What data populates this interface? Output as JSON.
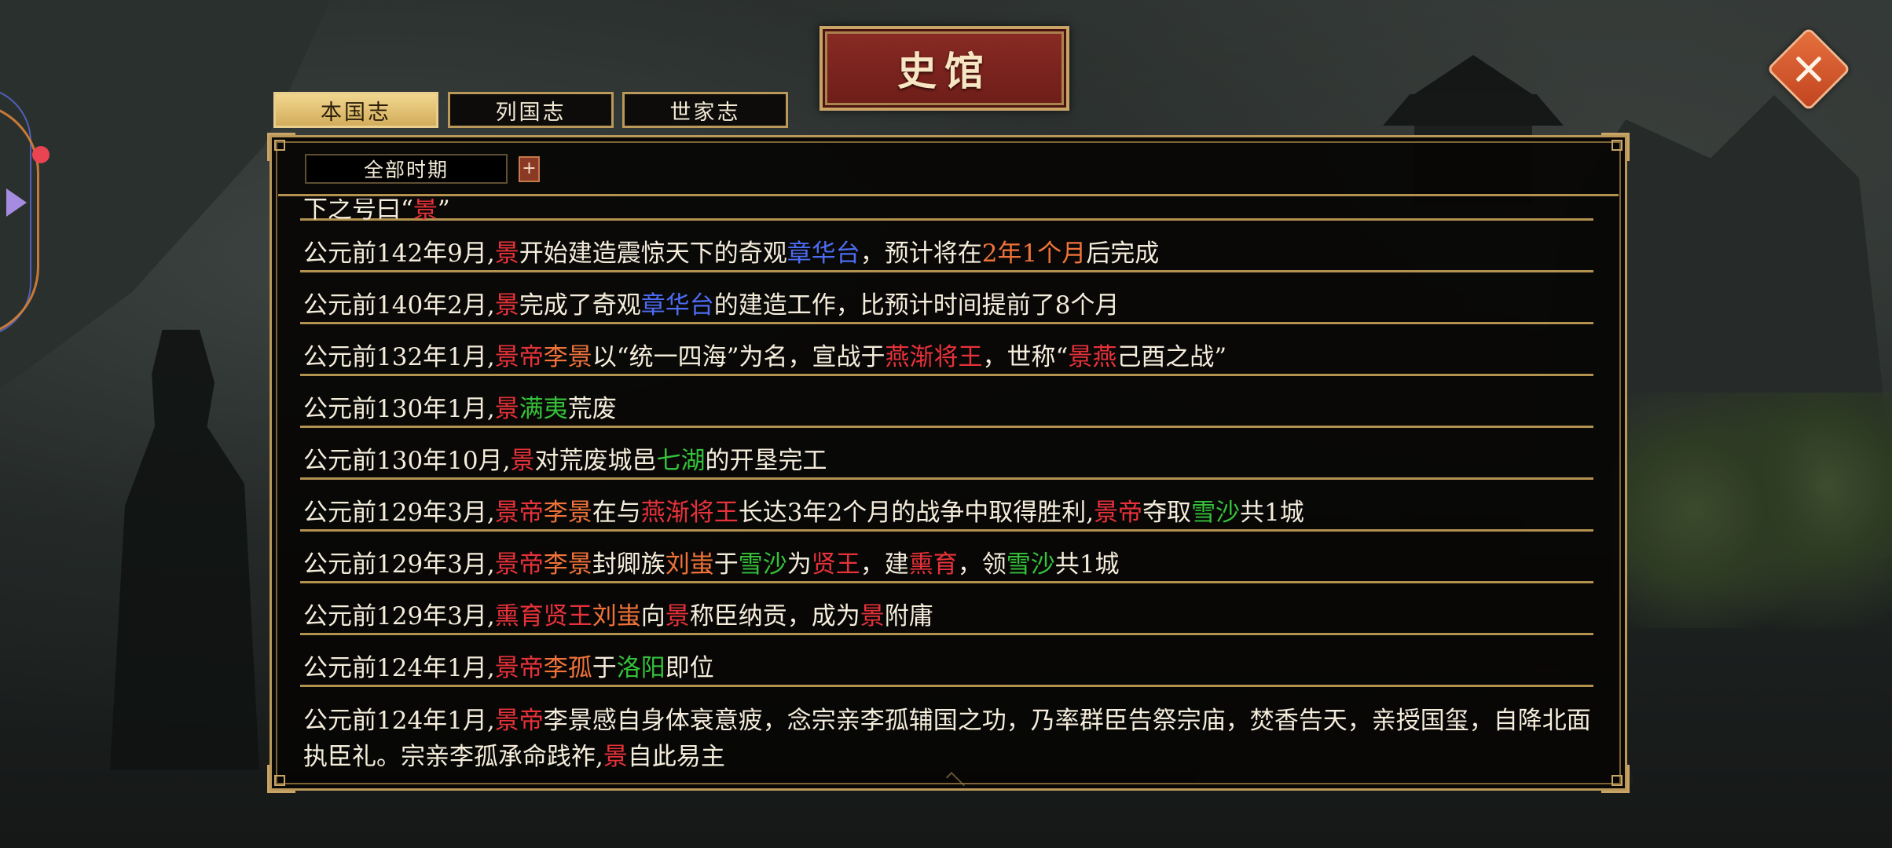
{
  "title": "史馆",
  "tabs": [
    {
      "label": "本国志",
      "active": true
    },
    {
      "label": "列国志",
      "active": false
    },
    {
      "label": "世家志",
      "active": false
    }
  ],
  "filter": {
    "period": "全部时期",
    "add_label": "+"
  },
  "colors": {
    "state_name": "#e8323a",
    "person_name": "#f0733a",
    "wonder": "#4d6cf2",
    "place": "#35c23a",
    "panel_border": "#b99859",
    "title_plaque": "#7a241f",
    "close_button": "#d65a2f"
  },
  "icons": {
    "close": "close-icon",
    "add": "plus-icon",
    "side_menu": "arrow-right-icon"
  },
  "entries": [
    {
      "segments": [
        {
          "t": "下之号曰“"
        },
        {
          "t": "景",
          "c": "red"
        },
        {
          "t": "”"
        }
      ]
    },
    {
      "segments": [
        {
          "t": "公元前142年9月,"
        },
        {
          "t": "景",
          "c": "red"
        },
        {
          "t": "开始建造震惊天下的奇观"
        },
        {
          "t": "章华台",
          "c": "blue"
        },
        {
          "t": "，预计将在"
        },
        {
          "t": "2年1个月",
          "c": "orange"
        },
        {
          "t": "后完成"
        }
      ]
    },
    {
      "segments": [
        {
          "t": "公元前140年2月,"
        },
        {
          "t": "景",
          "c": "red"
        },
        {
          "t": "完成了奇观"
        },
        {
          "t": "章华台",
          "c": "blue"
        },
        {
          "t": "的建造工作，比预计时间提前了8个月"
        }
      ]
    },
    {
      "segments": [
        {
          "t": "公元前132年1月,"
        },
        {
          "t": "景帝",
          "c": "red"
        },
        {
          "t": "李景",
          "c": "orange"
        },
        {
          "t": "以“统一四海”为名，宣战于"
        },
        {
          "t": "燕",
          "c": "red"
        },
        {
          "t": "渐将王",
          "c": "red"
        },
        {
          "t": "，世称“"
        },
        {
          "t": "景",
          "c": "red"
        },
        {
          "t": "燕",
          "c": "red"
        },
        {
          "t": "己酉之战”"
        }
      ]
    },
    {
      "segments": [
        {
          "t": "公元前130年1月,"
        },
        {
          "t": "景",
          "c": "red"
        },
        {
          "t": "满夷",
          "c": "green"
        },
        {
          "t": "荒废"
        }
      ]
    },
    {
      "segments": [
        {
          "t": "公元前130年10月,"
        },
        {
          "t": "景",
          "c": "red"
        },
        {
          "t": "对荒废城邑"
        },
        {
          "t": "七湖",
          "c": "green"
        },
        {
          "t": "的开垦完工"
        }
      ]
    },
    {
      "segments": [
        {
          "t": "公元前129年3月,"
        },
        {
          "t": "景帝",
          "c": "red"
        },
        {
          "t": "李景",
          "c": "orange"
        },
        {
          "t": "在与"
        },
        {
          "t": "燕",
          "c": "red"
        },
        {
          "t": "渐将王",
          "c": "red"
        },
        {
          "t": "长达3年2个月的战争中取得胜利,"
        },
        {
          "t": "景帝",
          "c": "red"
        },
        {
          "t": "夺取"
        },
        {
          "t": "雪沙",
          "c": "green"
        },
        {
          "t": "共1城"
        }
      ]
    },
    {
      "segments": [
        {
          "t": "公元前129年3月,"
        },
        {
          "t": "景帝",
          "c": "red"
        },
        {
          "t": "李景",
          "c": "orange"
        },
        {
          "t": "封卿族"
        },
        {
          "t": "刘蚩",
          "c": "orange"
        },
        {
          "t": "于"
        },
        {
          "t": "雪沙",
          "c": "green"
        },
        {
          "t": "为"
        },
        {
          "t": "贤王",
          "c": "red"
        },
        {
          "t": "，建"
        },
        {
          "t": "熏育",
          "c": "red"
        },
        {
          "t": "，领"
        },
        {
          "t": "雪沙",
          "c": "green"
        },
        {
          "t": "共1城"
        }
      ]
    },
    {
      "segments": [
        {
          "t": "公元前129年3月,"
        },
        {
          "t": "熏育贤王",
          "c": "red"
        },
        {
          "t": "刘蚩",
          "c": "orange"
        },
        {
          "t": "向"
        },
        {
          "t": "景",
          "c": "red"
        },
        {
          "t": "称臣纳贡，成为"
        },
        {
          "t": "景",
          "c": "red"
        },
        {
          "t": "附庸"
        }
      ]
    },
    {
      "segments": [
        {
          "t": "公元前124年1月,"
        },
        {
          "t": "景帝",
          "c": "red"
        },
        {
          "t": "李孤",
          "c": "orange"
        },
        {
          "t": "于"
        },
        {
          "t": "洛阳",
          "c": "green"
        },
        {
          "t": "即位"
        }
      ]
    },
    {
      "segments": [
        {
          "t": "公元前124年1月,"
        },
        {
          "t": "景帝",
          "c": "red"
        },
        {
          "t": "李景感自身体衰意疲，念宗亲李孤辅国之功，乃率群臣告祭宗庙，焚香告天，亲授国玺，自降北面执臣礼。宗亲李孤承命践祚,"
        },
        {
          "t": "景",
          "c": "red"
        },
        {
          "t": "自此易主"
        }
      ]
    }
  ]
}
